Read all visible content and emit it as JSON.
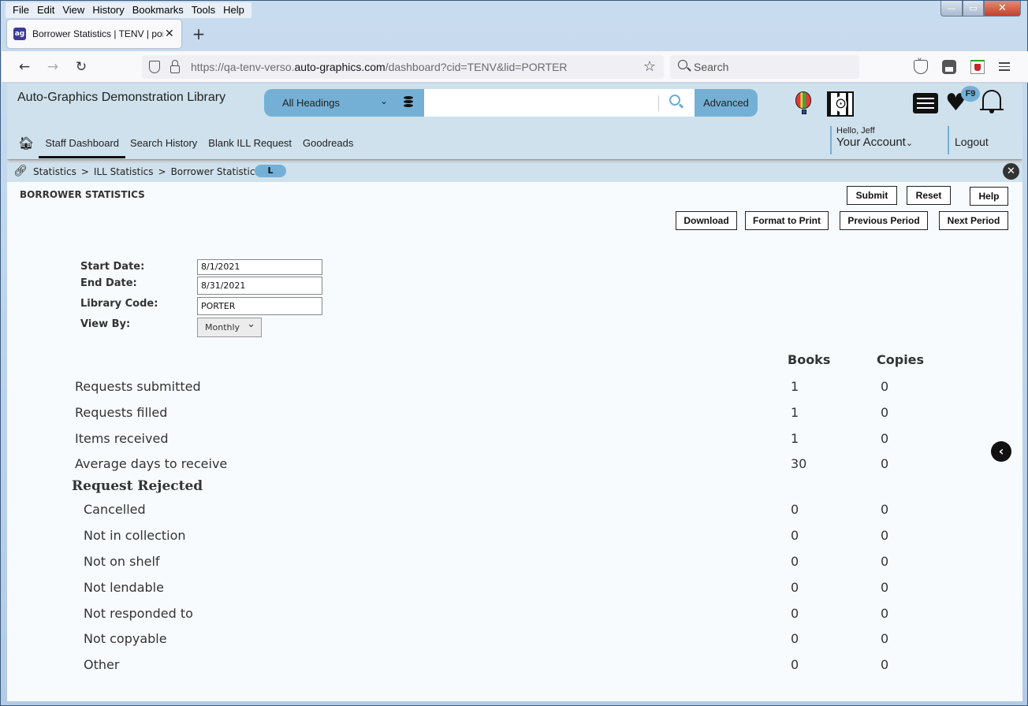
{
  "browser": {
    "menu": [
      "File",
      "Edit",
      "View",
      "History",
      "Bookmarks",
      "Tools",
      "Help"
    ],
    "tab_title": "Borrower Statistics | TENV | porter",
    "favicon": "ag",
    "url_prefix": "https://qa-tenv-verso.",
    "url_domain": "auto-graphics.com",
    "url_path": "/dashboard?cid=TENV&lid=PORTER",
    "search_placeholder": "Search",
    "window_controls": {
      "minimize": "—",
      "maximize": "▭",
      "close": "✕"
    },
    "icons": {
      "back": "←",
      "forward": "→",
      "reload": "↻",
      "star": "☆",
      "new_tab": "+",
      "tab_close": "✕"
    }
  },
  "header": {
    "library_name": "Auto-Graphics Demonstration Library",
    "search_scope": "All Headings",
    "search_value": "",
    "advanced_label": "Advanced",
    "badge": "F9",
    "nav": [
      "Staff Dashboard",
      "Search History",
      "Blank ILL Request",
      "Goodreads"
    ],
    "active_nav": "Staff Dashboard",
    "greeting": "Hello, Jeff",
    "account_label": "Your Account",
    "logout_label": "Logout"
  },
  "breadcrumb": {
    "items": [
      "Statistics",
      "ILL Statistics",
      "Borrower Statistics"
    ],
    "separator": ">",
    "pill": "L"
  },
  "page": {
    "title": "BORROWER STATISTICS",
    "buttons": {
      "submit": "Submit",
      "reset": "Reset",
      "help": "Help",
      "download": "Download",
      "format_to_print": "Format to Print",
      "previous_period": "Previous Period",
      "next_period": "Next Period"
    },
    "form": {
      "start_date_label": "Start Date:",
      "start_date": "8/1/2021",
      "end_date_label": "End Date:",
      "end_date": "8/31/2021",
      "library_code_label": "Library Code:",
      "library_code": "PORTER",
      "view_by_label": "View By:",
      "view_by": "Monthly"
    }
  },
  "stats": {
    "columns": [
      "Books",
      "Copies"
    ],
    "rows": [
      {
        "label": "Requests submitted",
        "books": "1",
        "copies": "0"
      },
      {
        "label": "Requests filled",
        "books": "1",
        "copies": "0"
      },
      {
        "label": "Items received",
        "books": "1",
        "copies": "0"
      },
      {
        "label": "Average days to receive",
        "books": "30",
        "copies": "0"
      }
    ],
    "rejected_heading": "Request Rejected",
    "rejected_rows": [
      {
        "label": "Cancelled",
        "books": "0",
        "copies": "0"
      },
      {
        "label": "Not in collection",
        "books": "0",
        "copies": "0"
      },
      {
        "label": "Not on shelf",
        "books": "0",
        "copies": "0"
      },
      {
        "label": "Not lendable",
        "books": "0",
        "copies": "0"
      },
      {
        "label": "Not responded to",
        "books": "0",
        "copies": "0"
      },
      {
        "label": "Not copyable",
        "books": "0",
        "copies": "0"
      },
      {
        "label": "Other",
        "books": "0",
        "copies": "0"
      }
    ]
  },
  "colors": {
    "header_bg": "#cfe1ec",
    "accent": "#74b0d6",
    "page_bg": "#f7fbfd"
  }
}
